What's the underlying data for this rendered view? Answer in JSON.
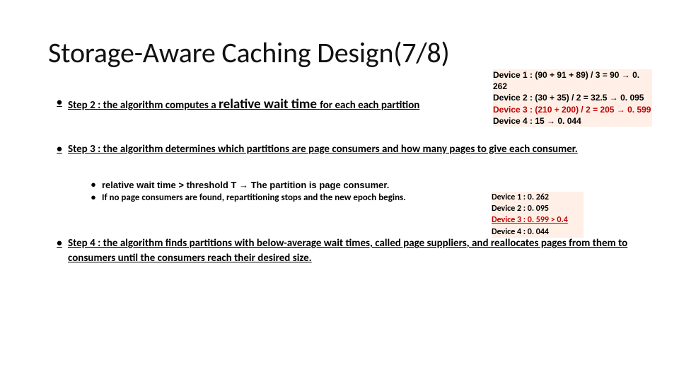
{
  "title": "Storage-Aware Caching Design(7/8)",
  "step2": {
    "prefix": "Step 2 : the algorithm computes a ",
    "emph": "relative wait time ",
    "suffix": "for each each partition"
  },
  "step3": "Step 3 : the algorithm determines which partitions are page consumers and how many pages to give each consumer.",
  "sub1": "relative wait time > threshold T → The partition is page consumer.",
  "sub2": "If no page consumers are found, repartitioning stops and the new epoch begins.",
  "step4": "Step 4 : the algorithm finds partitions with below-average wait times, called page suppliers, and reallocates pages from them to consumers until the consumers reach their desired size.",
  "calloutA": {
    "l1": "Device 1 : (90 + 91 + 89) / 3 = 90 → 0. 262",
    "l2": "Device 2 : (30 + 35) / 2 = 32.5 → 0. 095",
    "l3": "Device 3 : (210 + 200) / 2 = 205 → 0. 599",
    "l4": "Device 4 : 15 → 0. 044"
  },
  "calloutB": {
    "l1": "Device 1 : 0. 262",
    "l2": "Device 2 : 0. 095",
    "l3a": "Device 3 : 0. 599 > 0.4",
    "l4": "Device 4 : 0. 044"
  }
}
